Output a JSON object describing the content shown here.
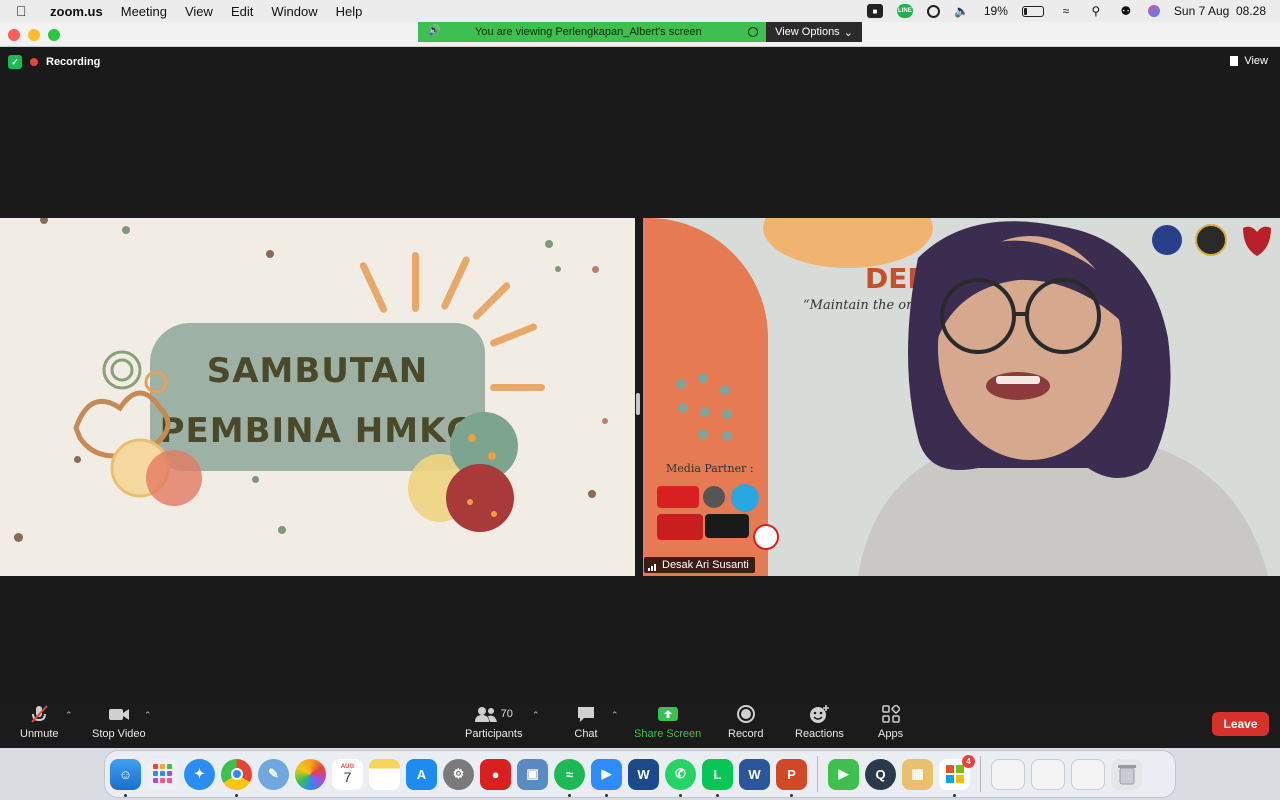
{
  "menubar": {
    "app_name": "zoom.us",
    "menus": [
      "Meeting",
      "View",
      "Edit",
      "Window",
      "Help"
    ],
    "battery_percent": "19%",
    "battery_level": 0.19,
    "datetime": "Sun 7 Aug  08.28",
    "line_icon_text": "LINE"
  },
  "banner": {
    "viewing_text": "You are viewing Perlengkapan_Albert's screen",
    "view_options_label": "View Options"
  },
  "meeting": {
    "recording_label": "Recording",
    "view_label": "View"
  },
  "slide": {
    "title_line1": "SAMBUTAN",
    "title_line2": "PEMBINA HMKG"
  },
  "speaker": {
    "name": "Desak Ari Susanti",
    "bg_title_fragment": "DEN",
    "bg_subtitle_fragment": "“Maintain the oral h",
    "media_partner_label": "Media Partner :"
  },
  "toolbar": {
    "unmute_label": "Unmute",
    "stop_video_label": "Stop Video",
    "participants_label": "Participants",
    "participants_count": "70",
    "chat_label": "Chat",
    "share_screen_label": "Share Screen",
    "record_label": "Record",
    "reactions_label": "Reactions",
    "apps_label": "Apps",
    "leave_label": "Leave"
  },
  "dock": {
    "calendar_month": "AUG",
    "calendar_day": "7",
    "badge_count": "4"
  },
  "colors": {
    "share_green": "#3fbf4f",
    "leave_red": "#d8312b",
    "slide_bg": "#f1ece4",
    "slide_blob": "#9db2a4"
  }
}
